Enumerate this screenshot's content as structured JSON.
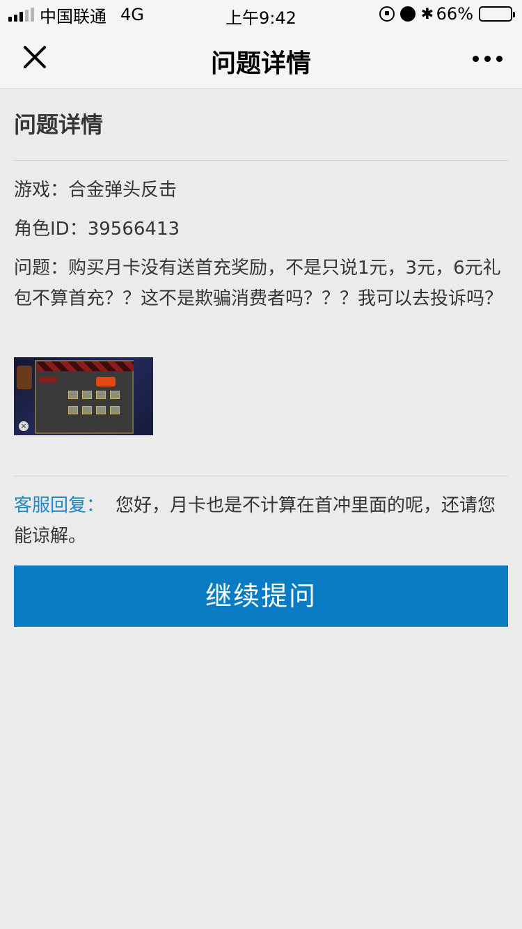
{
  "status_bar": {
    "carrier": "中国联通",
    "network": "4G",
    "time": "上午9:42",
    "battery": "66%",
    "battery_level": 0.66
  },
  "nav": {
    "title": "问题详情",
    "close_icon": "close-icon",
    "more_icon": "more-icon"
  },
  "detail": {
    "section_title": "问题详情",
    "game_label": "游戏：",
    "game_value": "合金弹头反击",
    "role_label": "角色ID：",
    "role_value": "39566413",
    "question_label": "问题：",
    "question_text": "购买月卡没有送首充奖励，不是只说1元，3元，6元礼包不算首充？？这不是欺骗消费者吗？？？我可以去投诉吗？"
  },
  "screenshot": {
    "icon": "game-screenshot-thumbnail"
  },
  "reply": {
    "label": "客服回复：",
    "text": "您好，月卡也是不计算在首冲里面的呢，还请您能谅解。"
  },
  "actions": {
    "continue_label": "继续提问"
  },
  "colors": {
    "accent": "#0a7cc3",
    "reply_label": "#1d88c7",
    "background": "#ebebeb"
  }
}
